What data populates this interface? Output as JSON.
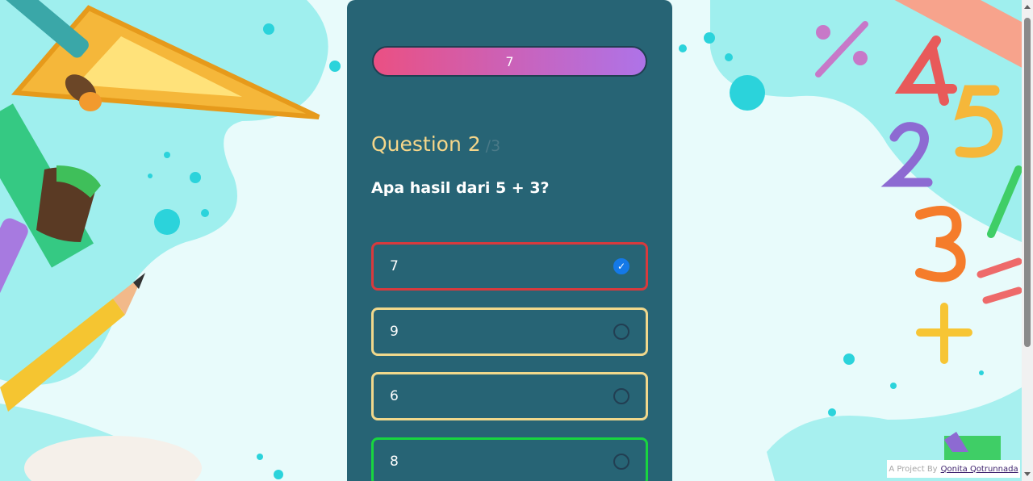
{
  "progress": {
    "label": "7"
  },
  "question": {
    "title": "Question 2",
    "total": "/3",
    "text": "Apa hasil dari 5 + 3?"
  },
  "options": [
    {
      "label": "7",
      "state": "wrong-selected"
    },
    {
      "label": "9",
      "state": "default"
    },
    {
      "label": "6",
      "state": "default"
    },
    {
      "label": "8",
      "state": "correct"
    }
  ],
  "credit": {
    "prefix": "A Project By",
    "author": "Qonita Qotrunnada"
  },
  "icons": {
    "selected": "check-icon"
  },
  "colors": {
    "card": "#276475",
    "accent_title": "#f5d68a",
    "wrong": "#d83a3d",
    "correct": "#18d63f",
    "default_border": "#f0d88c",
    "radio_checked": "#1479e8"
  }
}
